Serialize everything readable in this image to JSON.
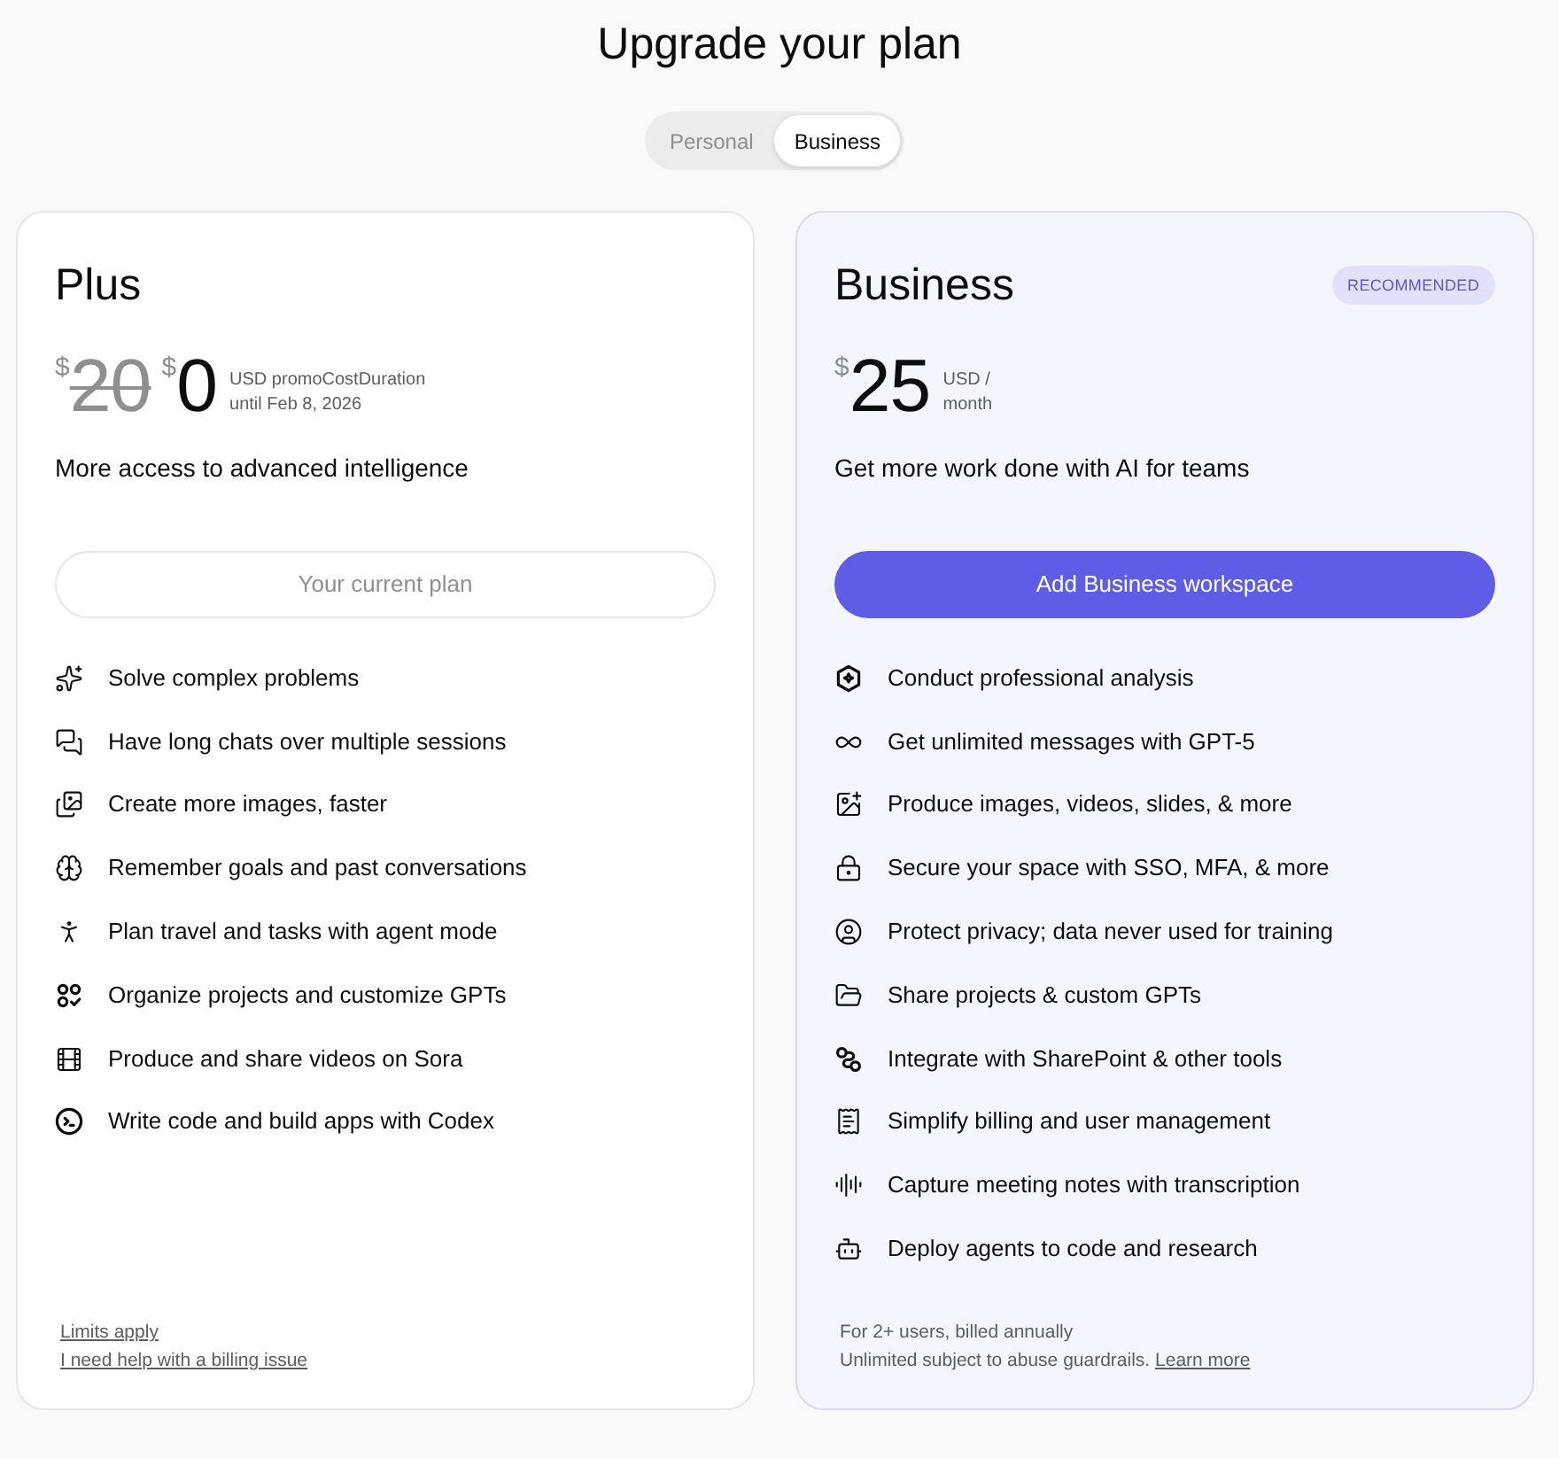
{
  "page": {
    "title": "Upgrade your plan"
  },
  "tabs": [
    {
      "label": "Personal",
      "selected": false
    },
    {
      "label": "Business",
      "selected": true
    }
  ],
  "plans": [
    {
      "kind": "standard",
      "name": "Plus",
      "prices": [
        {
          "currency": "$",
          "amount": "20",
          "struck": true
        },
        {
          "currency": "$",
          "amount": "0",
          "struck": false
        }
      ],
      "price_note": [
        "USD promoCostDuration",
        "until Feb 8, 2026"
      ],
      "description": "More access to advanced intelligence",
      "button": {
        "label": "Your current plan",
        "kind": "current"
      },
      "features": [
        "Solve complex problems",
        "Have long chats over multiple sessions",
        "Create more images, faster",
        "Remember goals and past conversations",
        "Plan travel and tasks with agent mode",
        "Organize projects and customize GPTs",
        "Produce and share videos on Sora",
        "Write code and build apps with Codex"
      ],
      "footer": [
        {
          "link": "Limits apply"
        },
        {
          "link": "I need help with a billing issue"
        }
      ]
    },
    {
      "kind": "featured",
      "name": "Business",
      "badge": "RECOMMENDED",
      "prices": [
        {
          "currency": "$",
          "amount": "25",
          "struck": false
        }
      ],
      "price_note": [
        "USD /",
        "month"
      ],
      "description": "Get more work done with AI for teams",
      "button": {
        "label": "Add Business workspace",
        "kind": "primary"
      },
      "features": [
        "Conduct professional analysis",
        "Get unlimited messages with GPT-5",
        "Produce images, videos, slides, & more",
        "Secure your space with SSO, MFA, & more",
        "Protect privacy; data never used for training",
        "Share projects & custom GPTs",
        "Integrate with SharePoint & other tools",
        "Simplify billing and user management",
        "Capture meeting notes with transcription",
        "Deploy agents to code and research"
      ],
      "footer": [
        {
          "text": "For 2+ users, billed annually"
        },
        {
          "text": "Unlimited subject to abuse guardrails.",
          "link": "Learn more"
        }
      ]
    }
  ]
}
